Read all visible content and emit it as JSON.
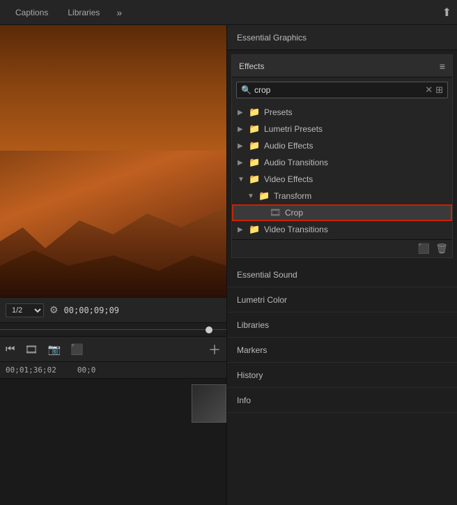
{
  "tabs": {
    "captions": "Captions",
    "libraries": "Libraries",
    "more_icon": "»",
    "export_icon": "⬆"
  },
  "controls": {
    "timecode": "1/2",
    "current_time": "00;00;09;09",
    "wrench": "🔧"
  },
  "timeline": {
    "timecode1": "00;01;36;02",
    "timecode2": "00;0"
  },
  "essential_graphics": {
    "label": "Essential Graphics"
  },
  "effects": {
    "title": "Effects",
    "menu_icon": "≡",
    "search_placeholder": "crop",
    "search_value": "crop",
    "tree": [
      {
        "id": "presets",
        "label": "Presets",
        "indent": 0,
        "arrow": "▶",
        "icon": "📁"
      },
      {
        "id": "lumetri_presets",
        "label": "Lumetri Presets",
        "indent": 0,
        "arrow": "▶",
        "icon": "📁"
      },
      {
        "id": "audio_effects",
        "label": "Audio Effects",
        "indent": 0,
        "arrow": "▶",
        "icon": "📁"
      },
      {
        "id": "audio_transitions",
        "label": "Audio Transitions",
        "indent": 0,
        "arrow": "▶",
        "icon": "📁"
      },
      {
        "id": "video_effects",
        "label": "Video Effects",
        "indent": 0,
        "arrow": "▼",
        "icon": "📁"
      },
      {
        "id": "transform",
        "label": "Transform",
        "indent": 1,
        "arrow": "▼",
        "icon": "📁"
      },
      {
        "id": "crop",
        "label": "Crop",
        "indent": 2,
        "arrow": "",
        "icon": "🎞",
        "selected": true
      },
      {
        "id": "video_transitions",
        "label": "Video Transitions",
        "indent": 0,
        "arrow": "▶",
        "icon": "📁"
      }
    ]
  },
  "panel_items": [
    {
      "id": "essential_sound",
      "label": "Essential Sound"
    },
    {
      "id": "lumetri_color",
      "label": "Lumetri Color"
    },
    {
      "id": "libraries",
      "label": "Libraries"
    },
    {
      "id": "markers",
      "label": "Markers"
    },
    {
      "id": "history",
      "label": "History"
    },
    {
      "id": "info",
      "label": "Info"
    }
  ]
}
